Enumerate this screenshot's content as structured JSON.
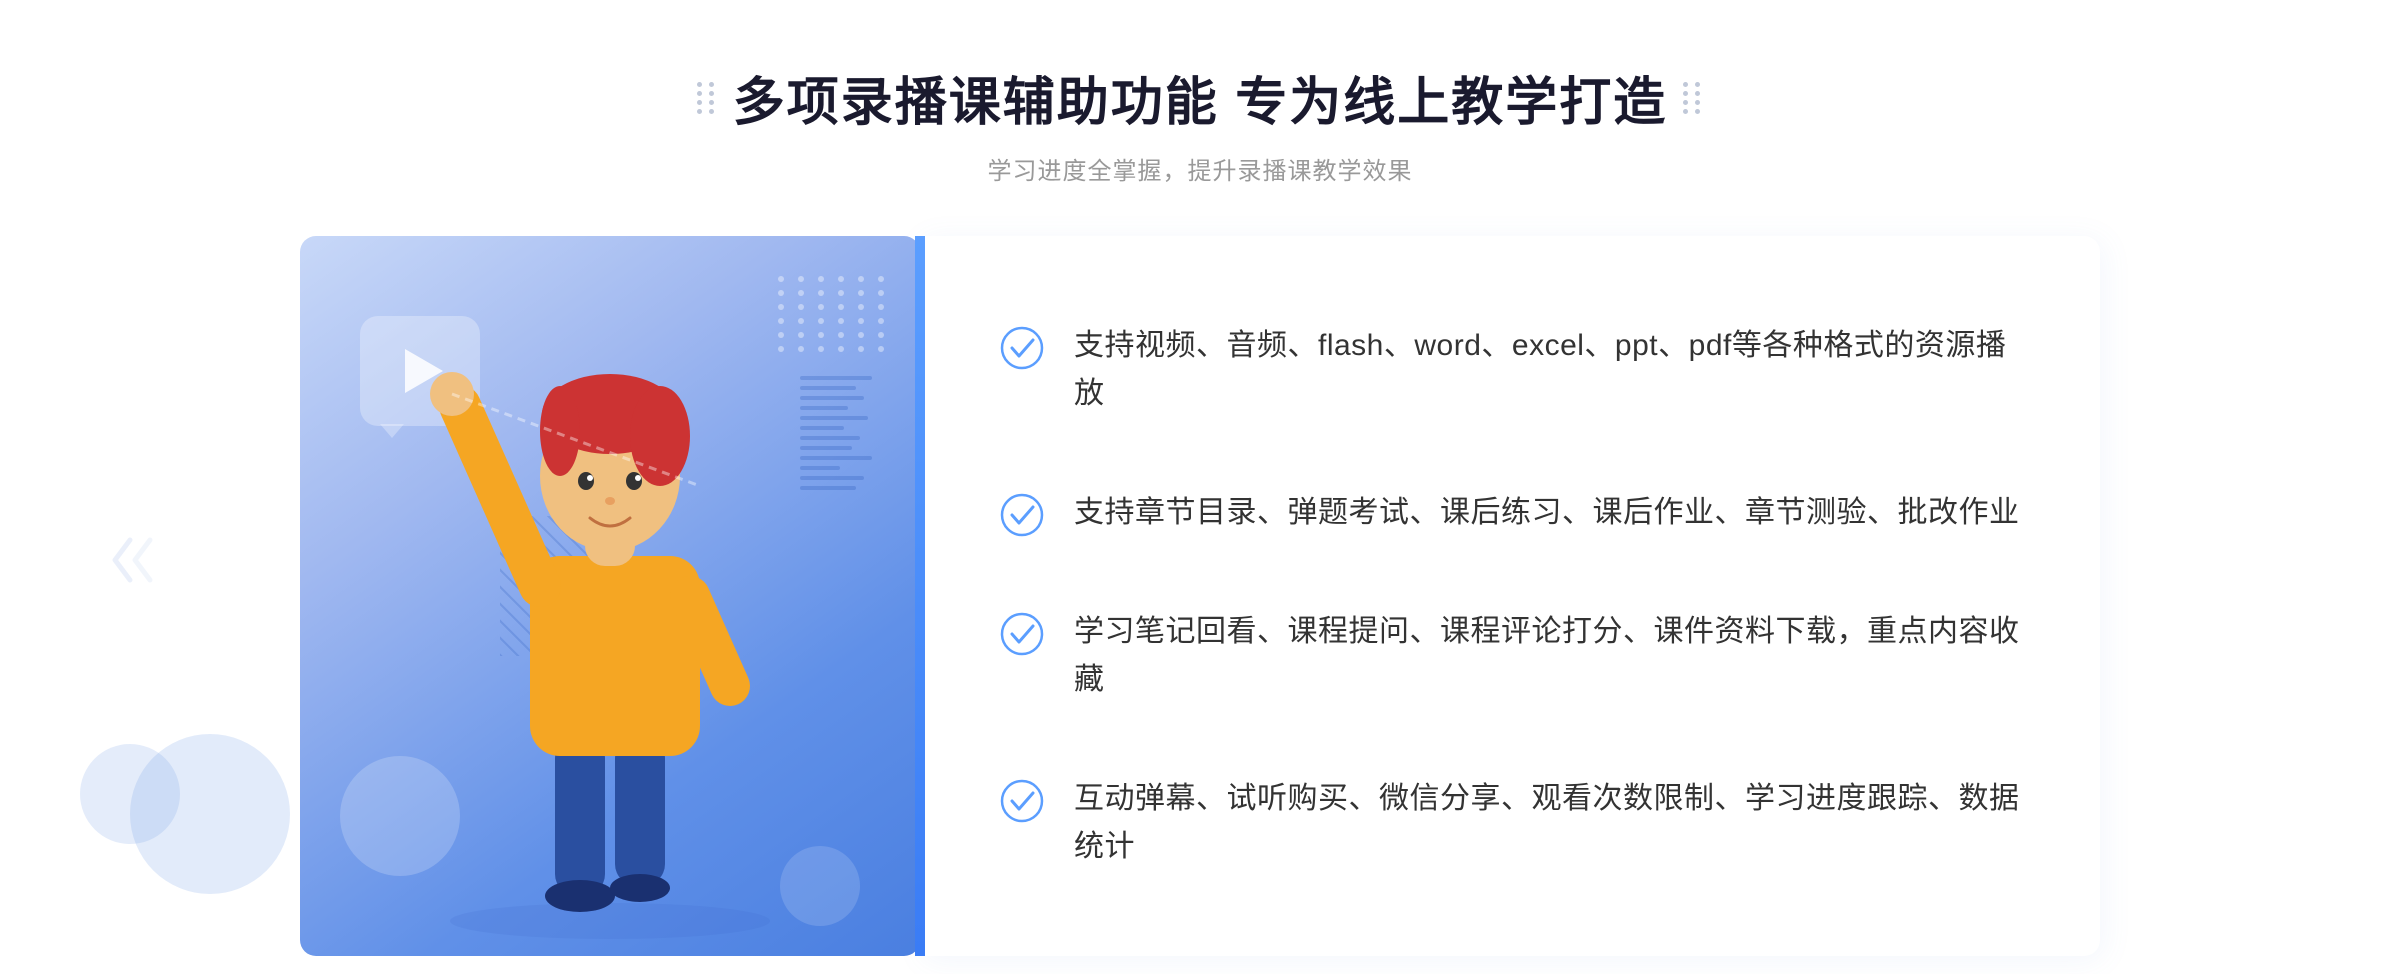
{
  "header": {
    "title": "多项录播课辅助功能 专为线上教学打造",
    "subtitle": "学习进度全掌握，提升录播课教学效果"
  },
  "features": [
    {
      "id": 1,
      "text": "支持视频、音频、flash、word、excel、ppt、pdf等各种格式的资源播放"
    },
    {
      "id": 2,
      "text": "支持章节目录、弹题考试、课后练习、课后作业、章节测验、批改作业"
    },
    {
      "id": 3,
      "text": "学习笔记回看、课程提问、课程评论打分、课件资料下载，重点内容收藏"
    },
    {
      "id": 4,
      "text": "互动弹幕、试听购买、微信分享、观看次数限制、学习进度跟踪、数据统计"
    }
  ],
  "colors": {
    "accent": "#4a7fe0",
    "check": "#5b9eff",
    "title": "#1a1a2e",
    "text": "#333333",
    "subtitle": "#999999"
  },
  "icons": {
    "check": "check-circle",
    "play": "play-triangle",
    "chevron": "chevron-right"
  }
}
